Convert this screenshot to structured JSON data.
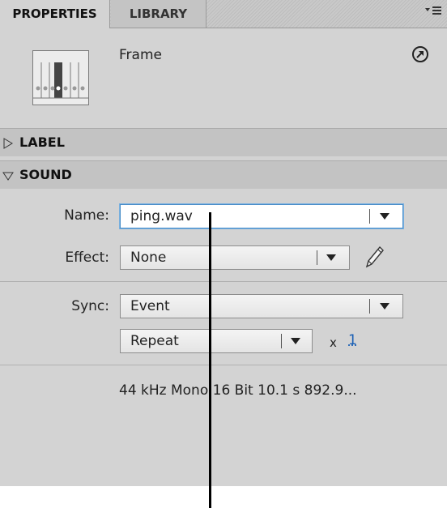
{
  "tabs": {
    "properties": "PROPERTIES",
    "library": "LIBRARY"
  },
  "icons": {
    "panel_menu": "panel-menu-icon",
    "goto": "goto-symbol-icon",
    "edit": "pencil-icon",
    "collapsed": "triangle-right-icon",
    "expanded": "triangle-down-icon"
  },
  "header": {
    "title": "Frame"
  },
  "sections": {
    "label": "LABEL",
    "sound": "SOUND"
  },
  "sound": {
    "name_label": "Name:",
    "name_value": "ping.wav",
    "effect_label": "Effect:",
    "effect_value": "None",
    "sync_label": "Sync:",
    "sync_value": "Event",
    "repeat_value": "Repeat",
    "times_symbol": "x",
    "repeat_count": "1",
    "info": "44 kHz Mono 16 Bit 10.1 s 892.9..."
  },
  "colors": {
    "panel_bg": "#d3d3d3",
    "section_bg": "#c3c3c3",
    "focus_border": "#4a8ec9",
    "link": "#1a5fb4"
  }
}
